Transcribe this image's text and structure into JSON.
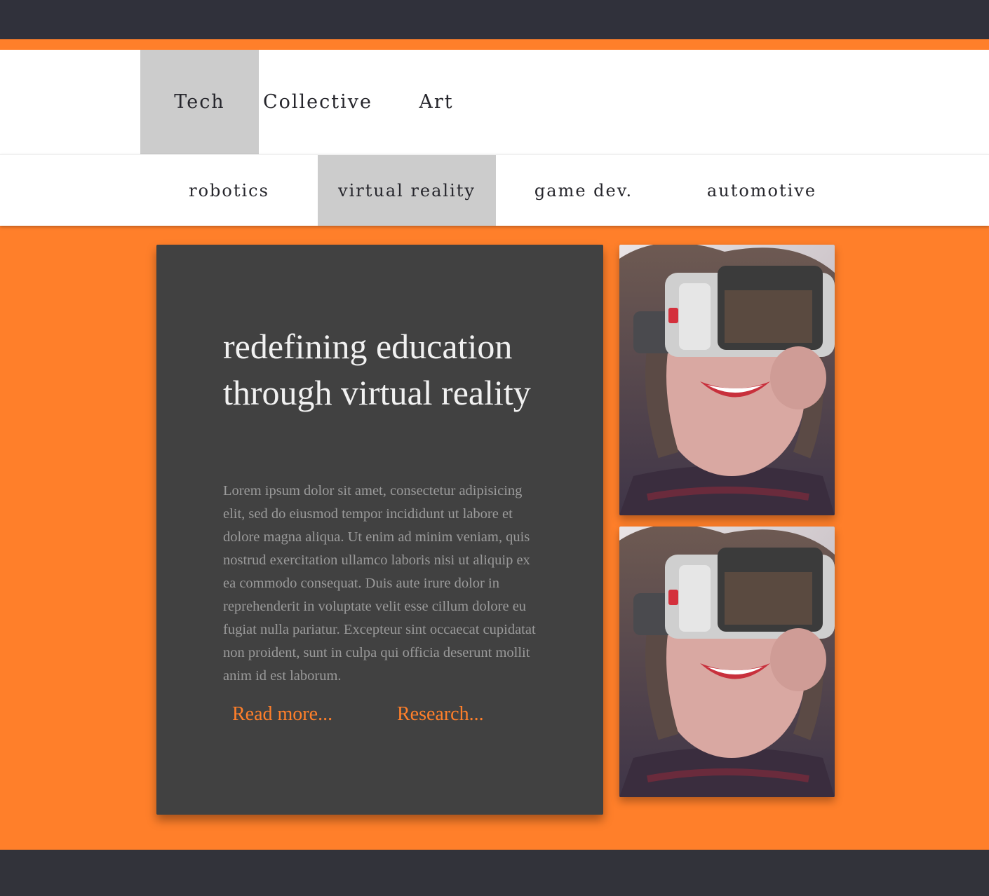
{
  "nav": {
    "primary": [
      {
        "label": "Tech",
        "active": true
      },
      {
        "label": "Collective",
        "active": false
      },
      {
        "label": "Art",
        "active": false
      }
    ],
    "secondary": [
      {
        "label": "robotics",
        "active": false
      },
      {
        "label": "virtual reality",
        "active": true
      },
      {
        "label": "game dev.",
        "active": false
      },
      {
        "label": "automotive",
        "active": false
      }
    ]
  },
  "article": {
    "title": "redefining education through virtual reality",
    "body": "Lorem ipsum dolor sit amet, consectetur adipisicing elit, sed do eiusmod tempor incididunt ut labore et dolore magna aliqua. Ut enim ad minim veniam, quis nostrud exercitation ullamco laboris nisi ut aliquip ex ea commodo consequat. Duis aute irure dolor in reprehenderit in voluptate velit esse cillum dolore eu fugiat nulla pariatur. Excepteur sint occaecat cupidatat non proident, sunt in culpa qui officia deserunt mollit anim id est laborum.",
    "links": {
      "read_more": "Read more...",
      "research": "Research..."
    }
  },
  "colors": {
    "accent": "#ff7f2a",
    "topbar": "#30313b",
    "card": "#414141",
    "active_tab": "#cccccc",
    "footer": "#32333a"
  },
  "images": [
    {
      "subject": "woman-wearing-vr-headset-photo"
    },
    {
      "subject": "woman-wearing-vr-headset-photo"
    }
  ]
}
